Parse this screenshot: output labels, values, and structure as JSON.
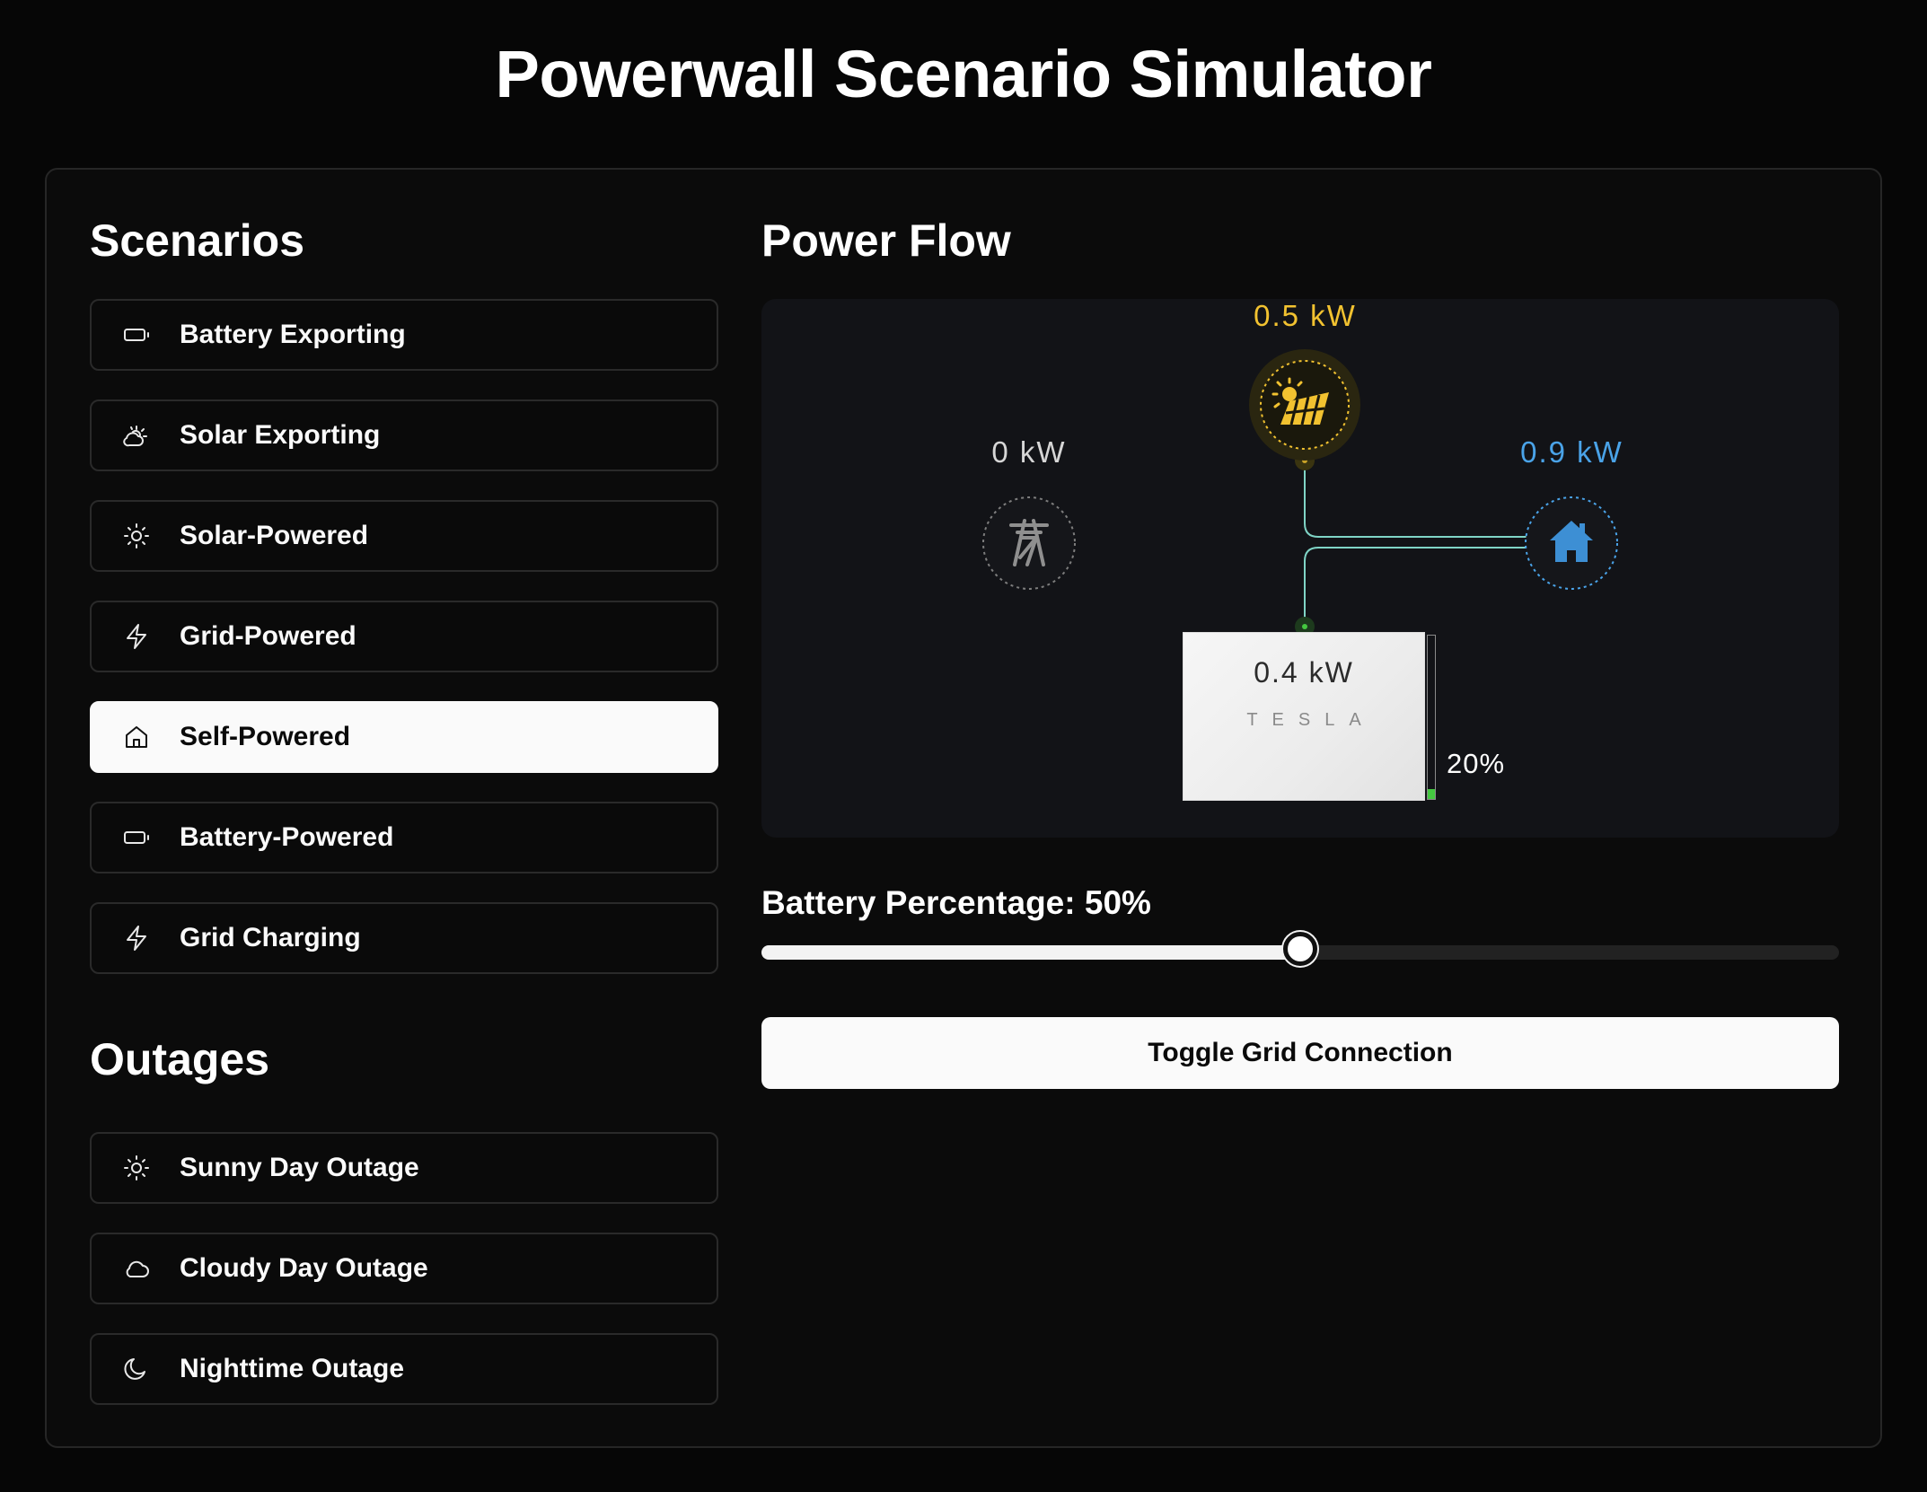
{
  "title": "Powerwall Scenario Simulator",
  "scenarios": {
    "heading": "Scenarios",
    "items": [
      {
        "label": "Battery Exporting",
        "icon": "battery-icon"
      },
      {
        "label": "Solar Exporting",
        "icon": "sun-cloud-icon"
      },
      {
        "label": "Solar-Powered",
        "icon": "sun-icon"
      },
      {
        "label": "Grid-Powered",
        "icon": "lightning-icon"
      },
      {
        "label": "Self-Powered",
        "icon": "home-icon",
        "active": true
      },
      {
        "label": "Battery-Powered",
        "icon": "battery-icon"
      },
      {
        "label": "Grid Charging",
        "icon": "lightning-icon"
      }
    ]
  },
  "outages": {
    "heading": "Outages",
    "items": [
      {
        "label": "Sunny Day Outage",
        "icon": "sun-icon"
      },
      {
        "label": "Cloudy Day Outage",
        "icon": "cloud-icon"
      },
      {
        "label": "Nighttime Outage",
        "icon": "moon-icon"
      }
    ]
  },
  "power_flow": {
    "heading": "Power Flow",
    "solar": {
      "value": "0.5 kW",
      "color": "#f2c230",
      "icon": "solar-panel-icon"
    },
    "grid": {
      "value": "0 kW",
      "color": "#d6d6d6",
      "icon": "power-tower-icon"
    },
    "home": {
      "value": "0.9 kW",
      "color": "#4aa3e8",
      "icon": "house-icon"
    },
    "battery": {
      "value": "0.4 kW",
      "brand": "TESLA",
      "charge_label": "20%",
      "charge_fraction": 0.2,
      "charge_color": "#44c740"
    },
    "line_color": "#7fd4c6"
  },
  "slider": {
    "label": "Battery Percentage: 50%",
    "value": 50,
    "max": 100
  },
  "toggle_button": {
    "label": "Toggle Grid Connection"
  }
}
